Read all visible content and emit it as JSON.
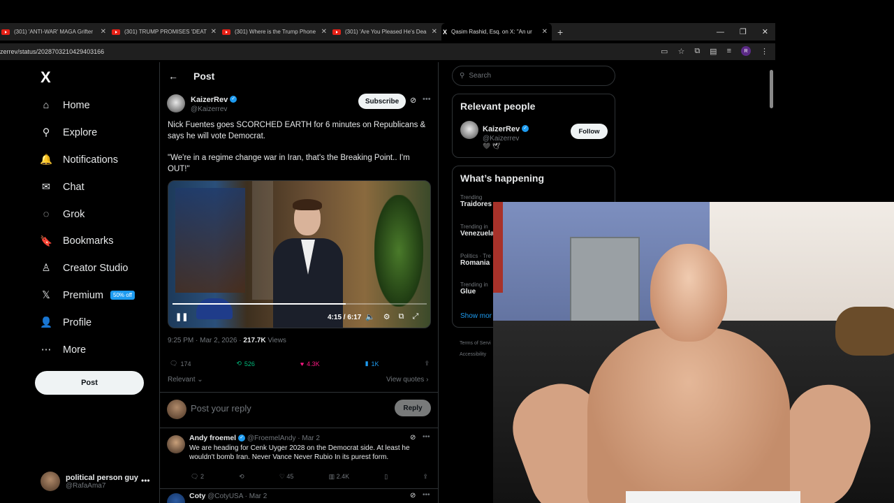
{
  "browser": {
    "tabs": [
      {
        "title": "(301) 'ANTI-WAR' MAGA Grifter",
        "type": "youtube"
      },
      {
        "title": "(301) TRUMP PROMISES 'DEATH",
        "type": "youtube"
      },
      {
        "title": "(301) Where is the Trump Phone",
        "type": "youtube"
      },
      {
        "title": "(301) 'Are You Pleased He's Dea",
        "type": "youtube"
      },
      {
        "title": "Qasim Rashid, Esq. on X: \"An ur",
        "type": "x"
      }
    ],
    "new_tab": "+",
    "url": "zerrev/status/2028703210429403166",
    "profile_initial": "R"
  },
  "nav": {
    "logo": "X",
    "items": [
      {
        "label": "Home",
        "icon": "home-icon",
        "glyph": "⌂"
      },
      {
        "label": "Explore",
        "icon": "search-icon",
        "glyph": "⚲"
      },
      {
        "label": "Notifications",
        "icon": "bell-icon",
        "glyph": "🔔"
      },
      {
        "label": "Chat",
        "icon": "mail-icon",
        "glyph": "✉"
      },
      {
        "label": "Grok",
        "icon": "grok-icon",
        "glyph": "◌"
      },
      {
        "label": "Bookmarks",
        "icon": "bookmark-icon",
        "glyph": "🔖"
      },
      {
        "label": "Creator Studio",
        "icon": "creator-icon",
        "glyph": "♙"
      },
      {
        "label": "Premium",
        "icon": "x-premium-icon",
        "glyph": "𝕏"
      },
      {
        "label": "Profile",
        "icon": "profile-icon",
        "glyph": "👤"
      },
      {
        "label": "More",
        "icon": "more-circle-icon",
        "glyph": "⋯"
      }
    ],
    "premium_badge": "50% off",
    "post_button": "Post",
    "account": {
      "name": "political person guy",
      "handle": "@RafaAma7"
    }
  },
  "post": {
    "header": "Post",
    "author": {
      "name": "KaizerRev",
      "handle": "@Kaizerrev"
    },
    "subscribe": "Subscribe",
    "text1": "Nick Fuentes goes SCORCHED EARTH for 6 minutes on Republicans & says he will vote Democrat.",
    "text2": "\"We're in a regime change war in Iran, that's the Breaking Point.. I'm OUT!\"",
    "video": {
      "time": "4:15 / 6:17",
      "progress": 0.68
    },
    "timestamp": "9:25 PM · Mar 2, 2026 · ",
    "views": "217.7K",
    "views_label": " Views",
    "stats": {
      "replies": "174",
      "reposts": "526",
      "likes": "4.3K",
      "bookmarks": "1K"
    },
    "sort": "Relevant",
    "view_quotes": "View quotes",
    "reply_placeholder": "Post your reply",
    "reply_button": "Reply"
  },
  "replies": [
    {
      "name": "Andy froemel",
      "handle": "@FroemelAndy · Mar 2",
      "text": "We are heading for Cenk Uyger 2028 on the Democrat side. At least he wouldn't bomb Iran. Never Vance Never Rubio In its purest form.",
      "stats": {
        "replies": "2",
        "reposts": "",
        "likes": "45",
        "views": "2.4K"
      }
    },
    {
      "name": "Coty",
      "handle": "@CotyUSA · Mar 2",
      "text": "",
      "stats": {}
    }
  ],
  "sidebar": {
    "search_placeholder": "Search",
    "relevant_title": "Relevant people",
    "relevant_person": {
      "name": "KaizerRev",
      "handle": "@Kaizerrev",
      "bio": "🖤 🕊",
      "follow": "Follow"
    },
    "happening_title": "What’s happening",
    "trends": [
      {
        "category": "Trending",
        "title": "Traidores"
      },
      {
        "category": "Trending in",
        "title": "Venezuela"
      },
      {
        "category": "Politics · Tre",
        "title": "Romania"
      },
      {
        "category": "Trending in",
        "title": "Glue"
      }
    ],
    "show_more": "Show mor",
    "footer": [
      "Terms of Servi",
      "Accessibility"
    ]
  },
  "colors": {
    "accent": "#1d9bf0",
    "like": "#f91880",
    "repost": "#00ba7c"
  }
}
